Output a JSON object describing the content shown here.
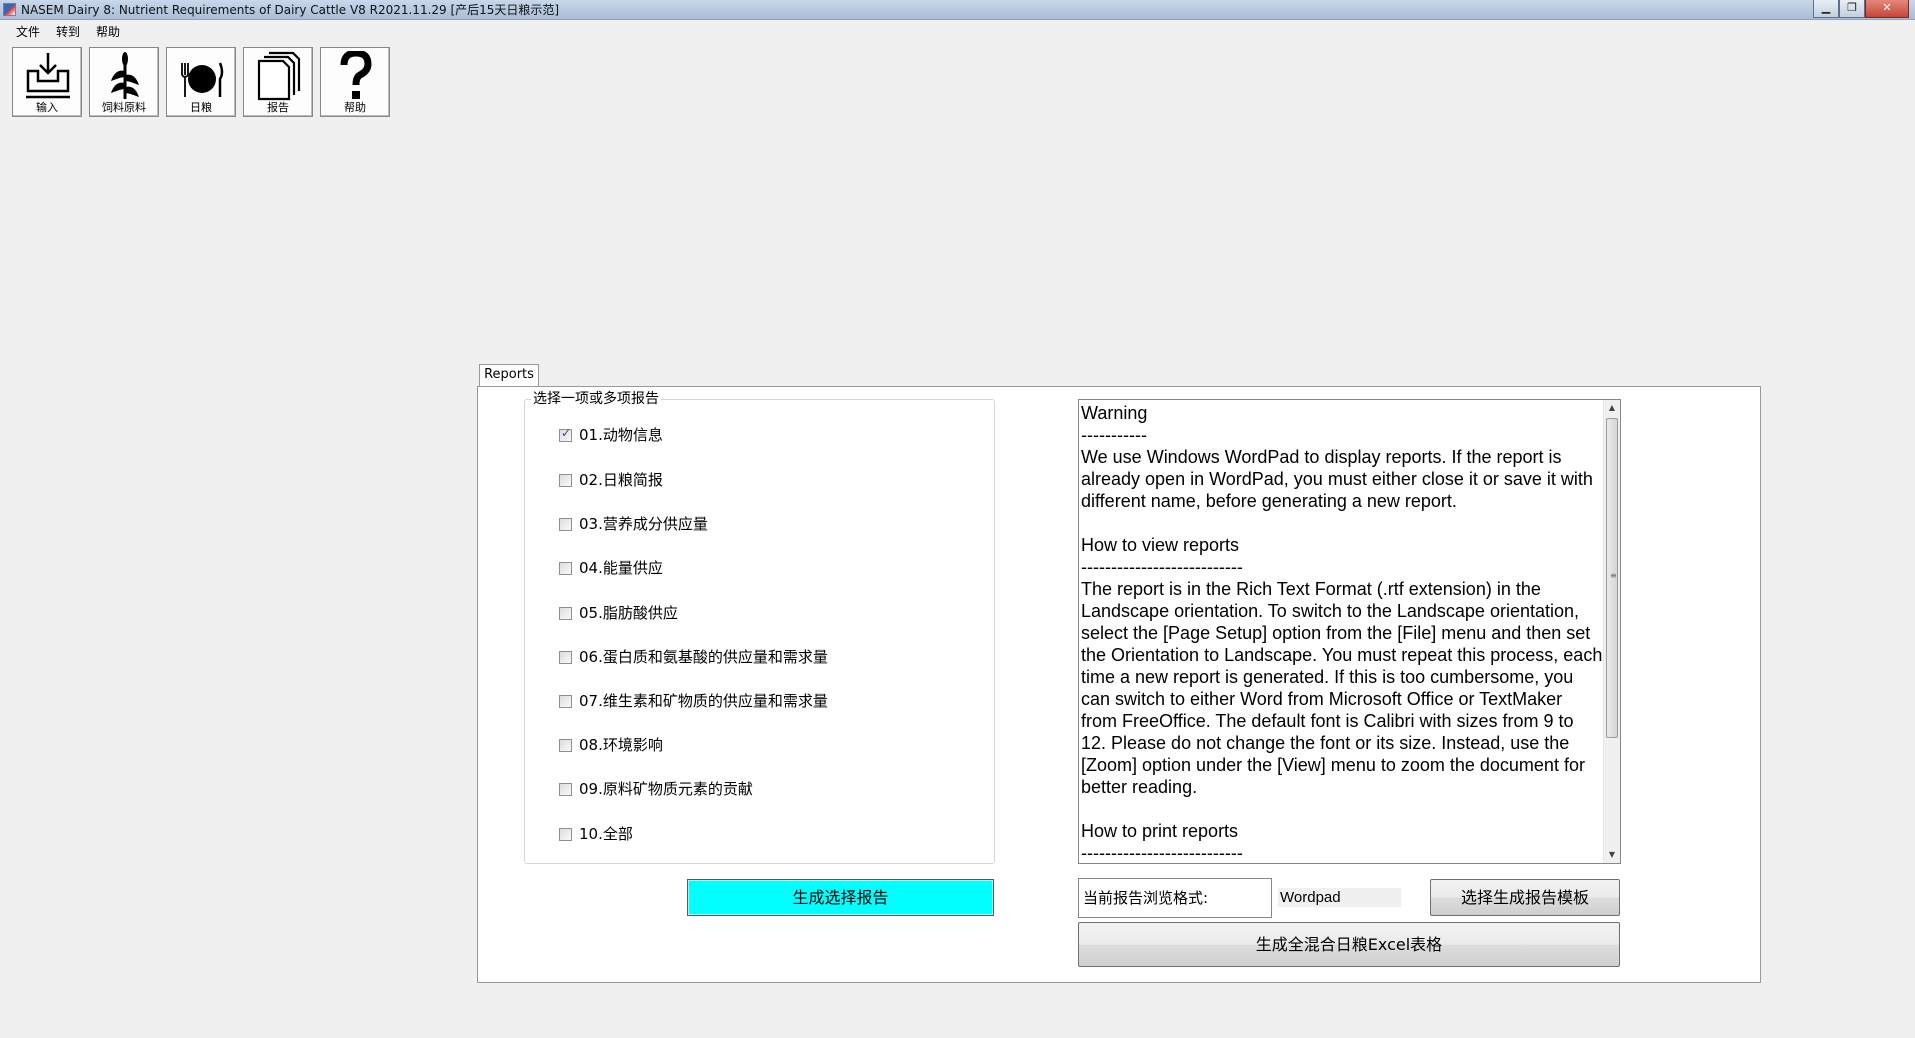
{
  "window": {
    "title": "NASEM Dairy 8: Nutrient Requirements of Dairy Cattle  V8 R2021.11.29 [产后15天日粮示范]",
    "minimize_glyph": "▁",
    "maximize_glyph": "❐",
    "close_glyph": "✕"
  },
  "menu": {
    "items": [
      "文件",
      "转到",
      "帮助"
    ]
  },
  "toolbar": {
    "buttons": [
      {
        "label": "输入",
        "icon": "input-tray-icon"
      },
      {
        "label": "饲料原料",
        "icon": "corn-plant-icon"
      },
      {
        "label": "日粮",
        "icon": "plate-fork-knife-icon"
      },
      {
        "label": "报告",
        "icon": "report-pages-icon"
      },
      {
        "label": "帮助",
        "icon": "question-mark-icon"
      }
    ]
  },
  "reports": {
    "tab_label": "Reports",
    "group_title": "选择一项或多项报告",
    "options": [
      {
        "label": "01.动物信息",
        "checked": true
      },
      {
        "label": "02.日粮简报",
        "checked": false
      },
      {
        "label": "03.营养成分供应量",
        "checked": false
      },
      {
        "label": "04.能量供应",
        "checked": false
      },
      {
        "label": "05.脂肪酸供应",
        "checked": false
      },
      {
        "label": "06.蛋白质和氨基酸的供应量和需求量",
        "checked": false
      },
      {
        "label": "07.维生素和矿物质的供应量和需求量",
        "checked": false
      },
      {
        "label": "08.环境影响",
        "checked": false
      },
      {
        "label": "09.原料矿物质元素的贡献",
        "checked": false
      },
      {
        "label": "10.全部",
        "checked": false
      }
    ],
    "generate_button": "生成选择报告",
    "info_text": "Warning\n-----------\nWe use Windows WordPad to display reports. If the report is already open in WordPad, you must either close it or save it with different name, before generating a new report.\n\nHow to view reports\n---------------------------\nThe report is in the Rich Text Format (.rtf extension) in the Landscape orientation. To switch to the Landscape orientation, select the [Page Setup] option from the [File] menu and then set the Orientation to Landscape. You must repeat this process, each time a new report is generated. If this is too cumbersome, you can switch to either Word from Microsoft Office or TextMaker from FreeOffice. The default font is Calibri with sizes from 9 to 12. Please do not change the font or its size. Instead, use the [Zoom] option under the [View] menu to zoom the document for better reading.\n\nHow to print reports\n---------------------------",
    "format_label": "当前报告浏览格式:",
    "format_value": "Wordpad",
    "template_button": "选择生成报告模板",
    "excel_button": "生成全混合日粮Excel表格"
  },
  "colors": {
    "generate_button_bg": "#00ffff",
    "window_bg": "#f0f0f0",
    "panel_bg": "#ffffff"
  }
}
